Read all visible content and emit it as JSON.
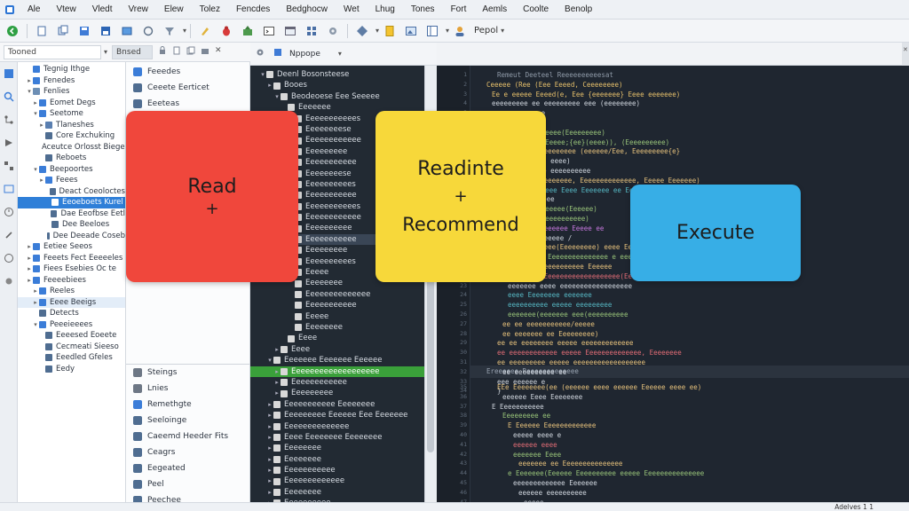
{
  "menu": [
    "Ale",
    "Vtew",
    "Vledt",
    "Vrew",
    "Elew",
    "Tolez",
    "Fencdes",
    "Bedghocw",
    "Wet",
    "Lhug",
    "Tones",
    "Fort",
    "Aemls",
    "Coolte",
    "Benolp"
  ],
  "toolbar": {
    "dropdown_label": "Pepol"
  },
  "left_panel": {
    "search_value": "Tooned",
    "tab_label": "Bnsed"
  },
  "dark_panel": {
    "tab_label": "Nppope"
  },
  "tree1": [
    {
      "label": "Tegnig Ithge",
      "d": 1,
      "tw": "",
      "c": "#3b7dd8"
    },
    {
      "label": "Fenedes",
      "d": 1,
      "tw": "▸",
      "c": "#3b7dd8"
    },
    {
      "label": "Fenlies",
      "d": 1,
      "tw": "▾",
      "c": "#6d8fb5"
    },
    {
      "label": "Eomet Degs",
      "d": 2,
      "tw": "▸",
      "c": "#3b7dd8"
    },
    {
      "label": "Seetome",
      "d": 2,
      "tw": "▾",
      "c": "#3b7dd8"
    },
    {
      "label": "Tlaneshes",
      "d": 3,
      "tw": "▸",
      "c": "#5a7fb0"
    },
    {
      "label": "Core Exchuking",
      "d": 3,
      "tw": "",
      "c": "#4f6d91"
    },
    {
      "label": "Aceutce Orlosst Bieges",
      "d": 3,
      "tw": "",
      "c": "#4f6d91"
    },
    {
      "label": "Reboets",
      "d": 3,
      "tw": "",
      "c": "#4f6d91"
    },
    {
      "label": "Beepoortes",
      "d": 2,
      "tw": "▾",
      "c": "#3b7dd8"
    },
    {
      "label": "Feees",
      "d": 3,
      "tw": "▸",
      "c": "#3b7dd8"
    },
    {
      "label": "Deact Coeoloctes",
      "d": 4,
      "tw": "",
      "c": "#4f6d91"
    },
    {
      "label": "Eeoeboets Kurel",
      "d": 4,
      "tw": "",
      "c": "#ffffff",
      "sel": true
    },
    {
      "label": "Dae Eeofbse Eetl",
      "d": 4,
      "tw": "",
      "c": "#4f6d91"
    },
    {
      "label": "Dee Beeloes",
      "d": 4,
      "tw": "",
      "c": "#4f6d91"
    },
    {
      "label": "Dee Deeade Coseb",
      "d": 4,
      "tw": "",
      "c": "#4f6d91"
    },
    {
      "label": "Eetiee Seeos",
      "d": 1,
      "tw": "▸",
      "c": "#3b7dd8"
    },
    {
      "label": "Feeets Fect Eeeeeles",
      "d": 1,
      "tw": "▸",
      "c": "#3b7dd8"
    },
    {
      "label": "Fiees Esebies Oc te",
      "d": 1,
      "tw": "▸",
      "c": "#3b7dd8"
    },
    {
      "label": "Feeeebiees",
      "d": 1,
      "tw": "▸",
      "c": "#3b7dd8"
    },
    {
      "label": "Reeles",
      "d": 2,
      "tw": "▸",
      "c": "#3b7dd8"
    },
    {
      "label": "Eeee Beeigs",
      "d": 2,
      "tw": "▸",
      "c": "#3b7dd8",
      "hl": true
    },
    {
      "label": "Detects",
      "d": 2,
      "tw": "",
      "c": "#4f6d91"
    },
    {
      "label": "Peeeieeees",
      "d": 2,
      "tw": "▾",
      "c": "#3b7dd8"
    },
    {
      "label": "Eeeesed Eoeete",
      "d": 3,
      "tw": "",
      "c": "#4f6d91"
    },
    {
      "label": "Cecmeati Sieeso",
      "d": 3,
      "tw": "",
      "c": "#4f6d91"
    },
    {
      "label": "Eeedled Gfeles",
      "d": 3,
      "tw": "",
      "c": "#4f6d91"
    },
    {
      "label": "Eedy",
      "d": 3,
      "tw": "",
      "c": "#4f6d91"
    }
  ],
  "tree2": [
    {
      "label": "Feeedes",
      "c": "#3b7dd8"
    },
    {
      "label": "Ceeete Eerticet",
      "c": "#4f6d91"
    },
    {
      "label": "Eeeteas",
      "c": "#4f6d91"
    },
    {
      "label": "Eeeee",
      "c": "#4f6d91"
    }
  ],
  "tree2b": [
    {
      "label": "Steings",
      "c": "#6d7785"
    },
    {
      "label": "Lnies",
      "c": "#6d7785"
    },
    {
      "label": "Remethgte",
      "c": "#3b7dd8"
    },
    {
      "label": "Seeloinge",
      "c": "#4f6d91"
    },
    {
      "label": "Caeemd Heeder Fits",
      "c": "#4f6d91"
    },
    {
      "label": "Ceagrs",
      "c": "#4f6d91"
    },
    {
      "label": "Eegeated",
      "c": "#4f6d91"
    },
    {
      "label": "Peel",
      "c": "#4f6d91"
    },
    {
      "label": "Peechee",
      "c": "#4f6d91"
    }
  ],
  "dark_tree": [
    {
      "label": "Deenl Bosonsteese",
      "d": 1,
      "tw": "▾"
    },
    {
      "label": "Booes",
      "d": 2,
      "tw": "▸"
    },
    {
      "label": "Beodeoese Eee Seeeee",
      "d": 3,
      "tw": "▾"
    },
    {
      "label": "Eeeeeee",
      "d": 4,
      "tw": ""
    },
    {
      "label": "Eeeeeeeeeees",
      "d": 5,
      "tw": ""
    },
    {
      "label": "Eeeeeeeese",
      "d": 5,
      "tw": ""
    },
    {
      "label": "Eeeeeeeeeeee",
      "d": 5,
      "tw": ""
    },
    {
      "label": "Eeeeeeeee",
      "d": 5,
      "tw": ""
    },
    {
      "label": "Eeeeeeeeeee",
      "d": 5,
      "tw": ""
    },
    {
      "label": "Eeeeeeeese",
      "d": 5,
      "tw": ""
    },
    {
      "label": "Eeeeeeeeees",
      "d": 5,
      "tw": ""
    },
    {
      "label": "Eeeeeeeeeee",
      "d": 5,
      "tw": ""
    },
    {
      "label": "Eeeeeeeeeees",
      "d": 5,
      "tw": ""
    },
    {
      "label": "Eeeeeeeeeeee",
      "d": 5,
      "tw": ""
    },
    {
      "label": "Eeeeeeeeee",
      "d": 5,
      "tw": ""
    },
    {
      "label": "Eeeeeeeeeee",
      "d": 5,
      "tw": "",
      "hl": true
    },
    {
      "label": "Eeeeeeeee",
      "d": 5,
      "tw": ""
    },
    {
      "label": "Eeeeeeeeees",
      "d": 5,
      "tw": ""
    },
    {
      "label": "Eeeee",
      "d": 5,
      "tw": ""
    },
    {
      "label": "Eeeeeeee",
      "d": 5,
      "tw": ""
    },
    {
      "label": "Eeeeeeeeeeeeee",
      "d": 5,
      "tw": ""
    },
    {
      "label": "Eeeeeeeeeee",
      "d": 5,
      "tw": ""
    },
    {
      "label": "Eeeee",
      "d": 5,
      "tw": ""
    },
    {
      "label": "Eeeeeeee",
      "d": 5,
      "tw": ""
    },
    {
      "label": "Eeee",
      "d": 4,
      "tw": ""
    },
    {
      "label": "Eeee",
      "d": 3,
      "tw": "▸"
    },
    {
      "label": "Eeeeeee Eeeeeee Eeeeee",
      "d": 2,
      "tw": "▾"
    },
    {
      "label": "Eeeeeeeeeeeeeeeeeee",
      "d": 3,
      "tw": "▸",
      "sel": true
    },
    {
      "label": "Eeeeeeeeeeee",
      "d": 3,
      "tw": "▸"
    },
    {
      "label": "Eeeeeeeee",
      "d": 3,
      "tw": "▸"
    },
    {
      "label": "Eeeeeeeeeee Eeeeeeee",
      "d": 2,
      "tw": "▸"
    },
    {
      "label": "Eeeeeeeee Eeeeee Eee Eeeeeee",
      "d": 2,
      "tw": "▸"
    },
    {
      "label": "Eeeeeeeeeeeeee",
      "d": 2,
      "tw": "▸"
    },
    {
      "label": "Eeee Eeeeeeee Eeeeeeee",
      "d": 2,
      "tw": "▸"
    },
    {
      "label": "Eeeeeeee",
      "d": 2,
      "tw": "▸"
    },
    {
      "label": "Eeeeeeee",
      "d": 2,
      "tw": "▸"
    },
    {
      "label": "Eeeeeeeeeee",
      "d": 2,
      "tw": "▸"
    },
    {
      "label": "Eeeeeeeeeeeee",
      "d": 2,
      "tw": "▸"
    },
    {
      "label": "Eeeeeeee",
      "d": 2,
      "tw": "▸"
    },
    {
      "label": "Eeeeeeeeee",
      "d": 2,
      "tw": "▸"
    }
  ],
  "code": {
    "top_lines": [
      {
        "t": "Remeut Deeteel Reeeeeeeeeesat",
        "c": "#8f9aa8",
        "i": 4
      },
      {
        "t": "Ceeeee (Ree (Eee Eeeed, Ceeeeeeee)",
        "c": "#e7c06b",
        "i": 2
      },
      {
        "t": "Ee e eeeee Eeeed(e, Eee {eeeeeee} Eeee eeeeeee)",
        "c": "#e7c06b",
        "i": 3
      },
      {
        "t": "eeeeeeeee ee eeeeeeeee eee (eeeeeeee)",
        "c": "#d0d6de",
        "i": 3
      },
      {
        "t": "eee eeeeeeee",
        "c": "#d0d6de",
        "i": 4
      },
      {
        "t": "{ee}",
        "c": "#e06c75",
        "i": 6
      },
      {
        "t": "ee  Ceeeeeeee(Eeeeeeeee)",
        "c": "#98c379",
        "i": 7
      },
      {
        "t": "eeeeeee(Eeeee;{ee}(eeee)), (Eeeeeeeeee)",
        "c": "#98c379",
        "i": 7
      },
      {
        "t": "eeeeeee Eeeeeeeee (eeeeee/Eee, Eeeeeeeee{e}",
        "c": "#e5c07b",
        "i": 6
      },
      {
        "t": "e   Eeee, eeee)",
        "c": "#d0d6de",
        "i": 8
      },
      {
        "t": "eeeee   e  eeeeeeeeee",
        "c": "#d0d6de",
        "i": 8
      },
      {
        "t": "eeeeee Eeeeeeeee, Eeeeeeeeeeeeee, Eeeee Eeeeeee)",
        "c": "#e5c07b",
        "i": 6
      },
      {
        "t": "eeeeee Eeee Eeee Eeeeeee ee Eeeeeeeee",
        "c": "#56b6c2",
        "i": 7
      },
      {
        "t": "Eeeeeeeee",
        "c": "#d0d6de",
        "i": 8
      },
      {
        "t": "eeeeeeeeeeeee(Eeeeee)",
        "c": "#98c379",
        "i": 7
      },
      {
        "t": "eeeeee(eeeeeeeeeee)",
        "c": "#98c379",
        "i": 7
      },
      {
        "t": "eeeeeeeeeeeeeee  Eeeee ee",
        "c": "#c678dd",
        "i": 6
      },
      {
        "t": "eee eeeeeeeeee /",
        "c": "#d0d6de",
        "i": 6
      },
      {
        "t": "eeee Eeeeeee(Eeeeeeeee) eeee Eeeeeeee",
        "c": "#e5c07b",
        "i": 6
      },
      {
        "t": "eeeeeeeee Eeeeeeeeeeeeeee e eeeeeee",
        "c": "#98c379",
        "i": 6
      },
      {
        "t": "ee Eeeeeeeeeeeeeeee Eeeeee",
        "c": "#e5c07b",
        "i": 6
      },
      {
        "t": "ee eeee/ Eeeeeeeeeeeeeeeeeee(Eeeeeee)",
        "c": "#e06c75",
        "i": 6
      },
      {
        "t": "eeeeeee eeee eeeeeeeeeeeeeeeeee",
        "c": "#d0d6de",
        "i": 6
      },
      {
        "t": "eeee Eeeeeeee eeeeeee",
        "c": "#56b6c2",
        "i": 6
      },
      {
        "t": "eeeeeeeeee eeeee eeeeeeeee",
        "c": "#56b6c2",
        "i": 6
      },
      {
        "t": "eeeeeee(eeeeeee eee(eeeeeeeeee",
        "c": "#98c379",
        "i": 6
      },
      {
        "t": "ee ee  eeeeeeeeeee/eeeee",
        "c": "#e5c07b",
        "i": 5
      },
      {
        "t": "ee eeeeeee ee Eeeeeeeee)",
        "c": "#e5c07b",
        "i": 5
      },
      {
        "t": "ee  ee eeeeeeee eeeee eeeeeeeeeeeee",
        "c": "#e5c07b",
        "i": 4
      },
      {
        "t": "ee  eeeeeeeeeeee eeeee Eeeeeeeeeeeeee, Eeeeeeee",
        "c": "#e06c75",
        "i": 4
      },
      {
        "t": "ee  eeeeeeeee eeeee eeeeeeeeeeeeeeeeee",
        "c": "#e5c07b",
        "i": 4
      },
      {
        "t": "ee eeeeeeeeee ee",
        "c": "#d0d6de",
        "i": 5
      },
      {
        "t": "eee eeeeee e",
        "c": "#d0d6de",
        "i": 4
      },
      {
        "t": "}",
        "c": "#d0d6de",
        "i": 4
      }
    ],
    "section_label": "Ereeeeee Reeeeeeeeeeeee",
    "bottom_lines": [
      {
        "t": "EEe Eeeeeeee(ee (eeeeee eeee eeeeee Eeeeee eeee ee)",
        "c": "#e5c07b",
        "i": 4
      },
      {
        "t": "eeeeee Eeee Eeeeeeee",
        "c": "#d0d6de",
        "i": 5
      },
      {
        "t": "E  Eeeeeeeeeee",
        "c": "#d0d6de",
        "i": 3
      },
      {
        "t": "Eeeeeeeee ee",
        "c": "#98c379",
        "i": 5
      },
      {
        "t": "E Eeeeee Eeeeeeeeeeeee",
        "c": "#e5c07b",
        "i": 6
      },
      {
        "t": "eeeee eeee e",
        "c": "#d0d6de",
        "i": 7
      },
      {
        "t": "eeeeee eeee",
        "c": "#e06c75",
        "i": 7
      },
      {
        "t": "eeeeeee Eeee",
        "c": "#98c379",
        "i": 7
      },
      {
        "t": "eeeeeee ee Eeeeeeeeeeeeeee",
        "c": "#e5c07b",
        "i": 8
      },
      {
        "t": "e  Eeeeeee(Eeeeee Eeeeeeeeee eeeee Eeeeeeeeeeeeeee",
        "c": "#98c379",
        "i": 6
      },
      {
        "t": "eeeeeeeeeeeee Eeeeeee",
        "c": "#d0d6de",
        "i": 7
      },
      {
        "t": "eeeeee eeeeeeeeee",
        "c": "#d0d6de",
        "i": 8
      },
      {
        "t": "eeeee",
        "c": "#d0d6de",
        "i": 9
      },
      {
        "t": "e  eeee eee",
        "c": "#e06c75",
        "i": 9
      },
      {
        "t": "eeeeeeeeeee eeeeeeeeee",
        "c": "#98c379",
        "i": 9
      },
      {
        "t": "eee eeeeeeee eeeeeeee Eeeeeeee eee",
        "c": "#e5c07b",
        "i": 9
      }
    ]
  },
  "cards": {
    "read": {
      "title": "Read",
      "plus": "+"
    },
    "readinte": {
      "title": "Readinte",
      "plus": "+",
      "subtitle": "Recommend"
    },
    "execute": {
      "title": "Execute"
    }
  },
  "status": {
    "text": "Adelves 1 1"
  }
}
